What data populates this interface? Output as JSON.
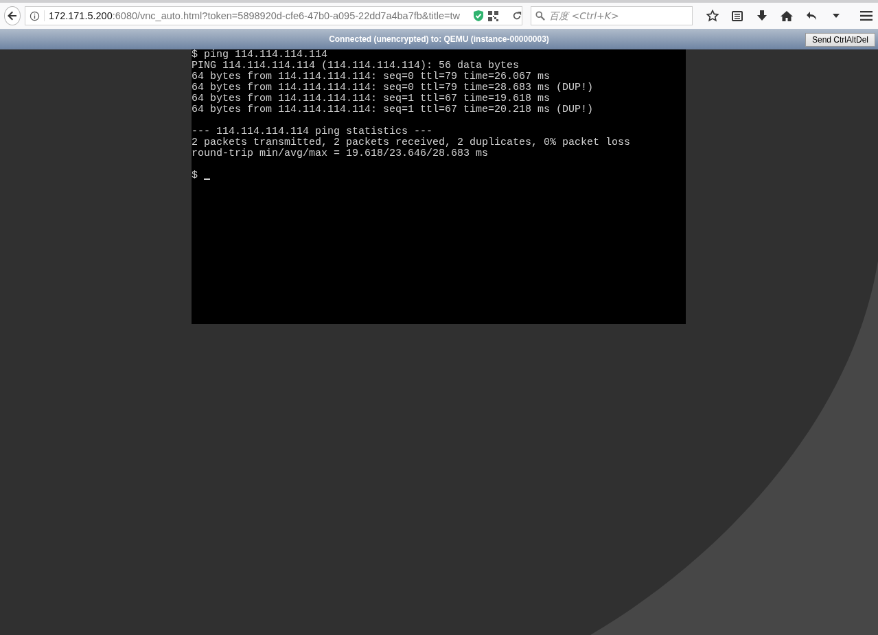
{
  "browser": {
    "url_host": "172.171.5.200",
    "url_rest": ":6080/vnc_auto.html?token=5898920d-cfe6-47b0-a095-22dd7a4ba7fb&title=tw",
    "search_placeholder": "百度 <Ctrl+K>"
  },
  "vnc_bar": {
    "status": "Connected (unencrypted) to: QEMU (instance-00000003)",
    "button": "Send CtrlAltDel"
  },
  "terminal": {
    "blocks": [
      [
        "$ ping 114.114.114.114",
        "PING 114.114.114.114 (114.114.114.114): 56 data bytes",
        "64 bytes from 114.114.114.114: seq=0 ttl=79 time=26.067 ms",
        "64 bytes from 114.114.114.114: seq=0 ttl=79 time=28.683 ms (DUP!)",
        "64 bytes from 114.114.114.114: seq=1 ttl=67 time=19.618 ms",
        "64 bytes from 114.114.114.114: seq=1 ttl=67 time=20.218 ms (DUP!)"
      ],
      [
        "--- 114.114.114.114 ping statistics ---",
        "2 packets transmitted, 2 packets received, 2 duplicates, 0% packet loss",
        "round-trip min/avg/max = 19.618/23.646/28.683 ms"
      ]
    ],
    "prompt": "$"
  }
}
